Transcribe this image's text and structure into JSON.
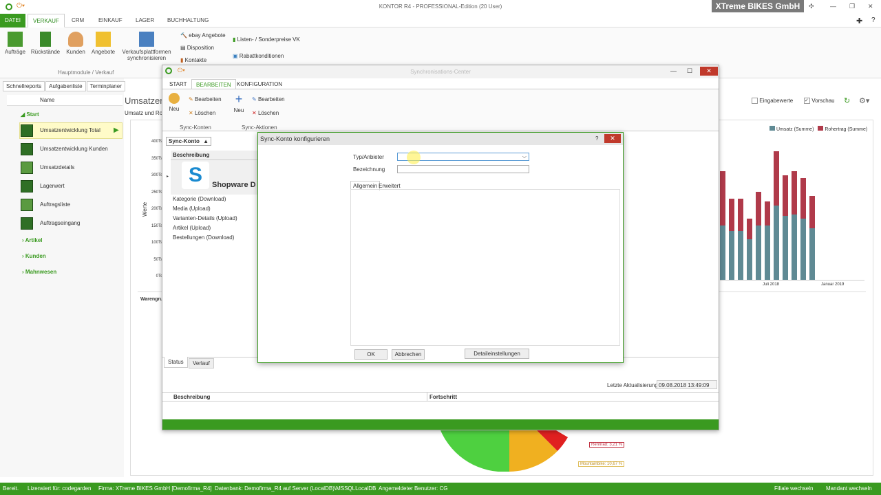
{
  "window": {
    "title": "KONTOR R4 - PROFESSIONAL-Edition (20 User)",
    "brand": "XTreme BIKES GmbH"
  },
  "menu": {
    "tabs": [
      "DATEI",
      "VERKAUF",
      "CRM",
      "EINKAUF",
      "LAGER",
      "BUCHHALTUNG"
    ],
    "active": "VERKAUF"
  },
  "ribbon": {
    "buttons": [
      "Aufträge",
      "Rückstände",
      "Kunden",
      "Angebote",
      "Verkaufsplattformen synchronisieren"
    ],
    "group_label": "Hauptmodule / Verkauf",
    "small": [
      "ebay Angebote",
      "Disposition",
      "Kontakte",
      "Listen- / Sonderpreise VK",
      "Rabattkonditionen"
    ]
  },
  "sidebar": {
    "tabs": [
      "Schnellreports",
      "Aufgabenliste",
      "Terminplaner"
    ],
    "column": "Name",
    "section_start": "Start",
    "items": [
      "Umsatzentwicklung Total",
      "Umsatzentwicklung Kunden",
      "Umsatzdetails",
      "Lagerwert",
      "Auftragsliste",
      "Auftragseingang"
    ],
    "sections": [
      "Artikel",
      "Kunden",
      "Mahnwesen"
    ]
  },
  "main": {
    "title": "Umsatzent",
    "subtitle": "Umsatz und Ro",
    "eingabewerte": "Eingabewerte",
    "vorschau": "Vorschau",
    "legend": [
      "Umsatz (Summe)",
      "Rohertrag (Summe)"
    ],
    "yticks": [
      "400Ts",
      "350Ts",
      "300Ts",
      "250Ts",
      "200Ts",
      "150Ts",
      "100Ts",
      "50Ts",
      "0Ts"
    ],
    "ylabel": "Werte",
    "xticks": [
      "Juli 2018",
      "Januar 2019"
    ],
    "warengruppe": "Warengru",
    "pie_labels": [
      "Rennrad: 3,21 %",
      "Mountainbike: 10,67 %"
    ]
  },
  "chart_data": {
    "type": "bar",
    "series": [
      {
        "name": "Umsatz (Summe)"
      },
      {
        "name": "Rohertrag (Summe)"
      }
    ]
  },
  "sync_center": {
    "title": "Synchronisations-Center",
    "tabs": [
      "START",
      "BEARBEITEN",
      "KONFIGURATION"
    ],
    "active_tab": "BEARBEITEN",
    "group1": {
      "new": "Neu",
      "edit": "Bearbeiten",
      "delete": "Löschen",
      "label": "Sync-Konten"
    },
    "group2": {
      "new": "Neu",
      "edit": "Bearbeiten",
      "delete": "Löschen",
      "label": "Sync-Aktionen"
    },
    "dropdown": "Sync-Konto",
    "column": "Beschreibung",
    "account": "Shopware D",
    "rows": [
      "Kategorie (Download)",
      "Media (Upload)",
      "Varianten-Details (Upload)",
      "Artikel (Upload)",
      "Bestellungen (Download)"
    ],
    "bottom_tabs": [
      "Status",
      "Verlauf"
    ],
    "last_update_label": "Letzte Aktualisierung",
    "last_update": "09.08.2018 13:49:09",
    "grid_cols": [
      "Beschreibung",
      "Fortschritt"
    ]
  },
  "dialog": {
    "title": "Sync-Konto konfigurieren",
    "help": "?",
    "type_label": "Typ/Anbieter",
    "name_label": "Bezeichnung",
    "tabs": [
      "Allgemein",
      "Erweitert"
    ],
    "ok": "OK",
    "cancel": "Abbrechen",
    "details": "Detaileinstellungen"
  },
  "statusbar": {
    "items": [
      "Bereit.",
      "Lizensiert für: codegarden",
      "Firma: XTreme BIKES GmbH [Demofirma_R4]",
      "Datenbank: Demofirma_R4 auf Server (LocalDB)\\MSSQLLocalDB",
      "Angemeldeter Benutzer: CG"
    ],
    "right": [
      "Filiale wechseln",
      "Mandant wechseln"
    ]
  },
  "colors": {
    "accent": "#3a9a20",
    "umsatz": "#5f8a94",
    "rohertrag": "#b03a4a"
  }
}
